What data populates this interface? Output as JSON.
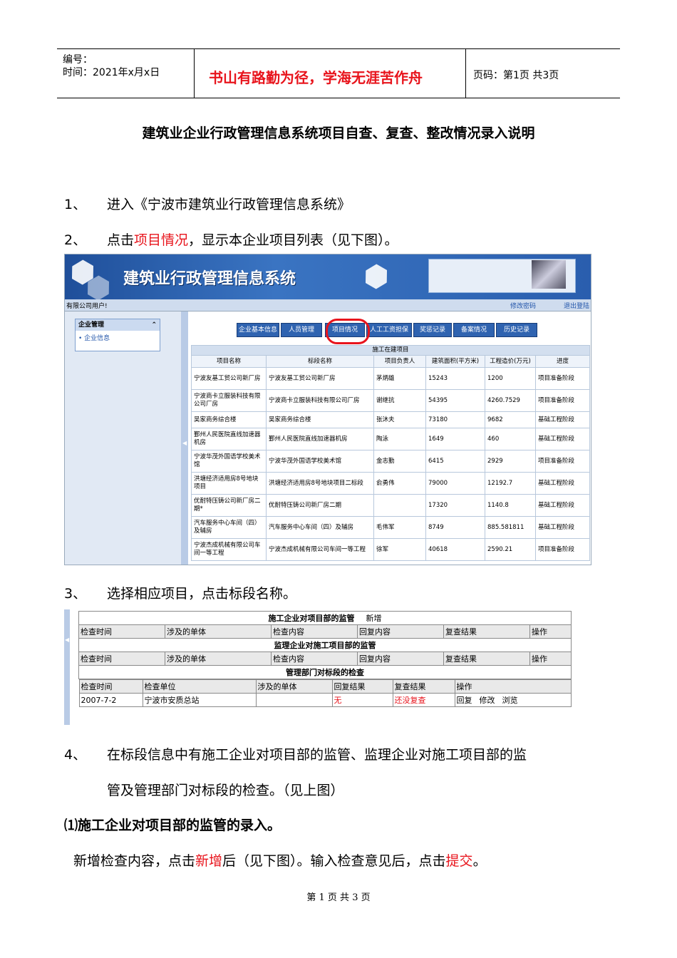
{
  "header": {
    "number_label": "编号：",
    "time_label": "时间：2021年x月x日",
    "motto": "书山有路勤为径，学海无涯苦作舟",
    "page_info": "页码：第1页  共3页"
  },
  "title": "建筑业企业行政管理信息系统项目自查、复查、整改情况录入说明",
  "steps": {
    "s1_num": "1、",
    "s1_text": "进入《宁波市建筑业行政管理信息系统》",
    "s2_num": "2、",
    "s2_pre": "点击",
    "s2_red": "项目情况",
    "s2_post": "，显示本企业项目列表（见下图）。",
    "s3_num": "3、",
    "s3_text": "选择相应项目，点击标段名称。",
    "s4_num": "4、",
    "s4_line1": "在标段信息中有施工企业对项目部的监管、监理企业对施工项目部的监",
    "s4_line2": "管及管理部门对标段的检查。（见上图）",
    "sub1": "⑴施工企业对项目部的监管的录入。",
    "last_pre": "新增检查内容，点击",
    "last_red1": "新增",
    "last_mid": "后（见下图）。输入检查意见后，点击",
    "last_red2": "提交",
    "last_end": "。"
  },
  "screenshot1": {
    "banner_title": "建筑业行政管理信息系统",
    "user_text": "有限公司用户!",
    "change_pwd": "修改密码",
    "logout": "退出登陆",
    "side_header": "企业管理",
    "side_item": "• 企业信息",
    "tabs": [
      "企业基本信息",
      "人员管理",
      "项目情况",
      "人工工资担保",
      "奖惩记录",
      "备案情况",
      "历史记录"
    ],
    "table_caption": "施工在建项目",
    "columns": [
      "项目名称",
      "标段名称",
      "项目负责人",
      "建筑面积(平方米)",
      "工程造价(万元)",
      "进度"
    ],
    "rows": [
      [
        "宁波友基工贸公司新厂房",
        "宁波友基工贸公司新厂房",
        "茅炳雄",
        "15243",
        "1200",
        "项目准备阶段"
      ],
      [
        "宁波商卡立服装科技有限公司厂房",
        "宁波商卡立服装科技有限公司厂房",
        "谢继抗",
        "54395",
        "4260.7529",
        "项目准备阶段"
      ],
      [
        "吴家商务综合楼",
        "吴家商务综合楼",
        "张沐夫",
        "73180",
        "9682",
        "基础工程阶段"
      ],
      [
        "鄞州人民医院直线加速器机房",
        "鄞州人民医院直线加速器机房",
        "陶泳",
        "1649",
        "460",
        "基础工程阶段"
      ],
      [
        "宁波华茂外国语学校美术馆",
        "宁波华茂外国语学校美术馆",
        "金志勤",
        "6415",
        "2929",
        "项目准备阶段"
      ],
      [
        "洪塘经济适用房8号地块项目",
        "洪塘经济适用房8号地块项目二标段",
        "俞勇伟",
        "79000",
        "12192.7",
        "基础工程阶段"
      ],
      [
        "优耐特压铸公司新厂房二期*",
        "优耐特压铸公司新厂房二期",
        "",
        "17320",
        "1140.8",
        "基础工程阶段"
      ],
      [
        "汽车服务中心车间（四）及辅房",
        "汽车服务中心车间（四）及辅房",
        "毛伟军",
        "8749",
        "885.581811",
        "基础工程阶段"
      ],
      [
        "宁波杰成机械有限公司车间一等工程",
        "宁波杰成机械有限公司车间一等工程",
        "徐军",
        "40618",
        "2590.21",
        "项目准备阶段"
      ]
    ]
  },
  "screenshot2": {
    "sec1_title": "施工企业对项目部的监管",
    "sec1_add": "新增",
    "sec_cols": [
      "检查时间",
      "涉及的单体",
      "检查内容",
      "回复内容",
      "复查结果",
      "操作"
    ],
    "sec2_title": "监理企业对施工项目部的监管",
    "sec3_title": "管理部门对标段的检查",
    "sec3_cols": [
      "检查时间",
      "检查单位",
      "涉及的单体",
      "回复结果",
      "复查结果",
      "操作"
    ],
    "sec3_row": {
      "date": "2007-7-2",
      "unit": "宁波市安质总站",
      "single": "",
      "reply": "无",
      "recheck": "还没复查",
      "op1": "回复",
      "op2": "修改",
      "op3": "浏览"
    }
  },
  "footer": "第 1 页 共 3 页"
}
